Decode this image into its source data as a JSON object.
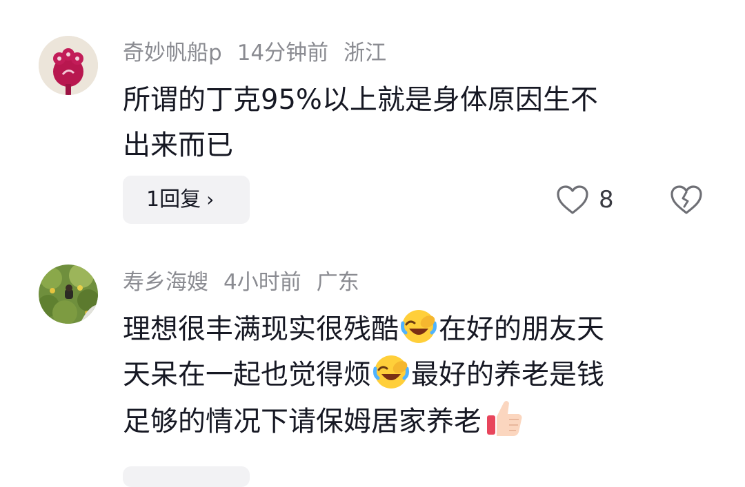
{
  "comments": [
    {
      "username": "奇妙帆船p",
      "time": "14分钟前",
      "location": "浙江",
      "line1": "所谓的丁克95%以上就是身体原因生不",
      "line2": "出来而已",
      "reply_label": "1回复",
      "reply_chevron": "›",
      "like_count": "8",
      "avatar_icon": "avatar-flower-icon"
    },
    {
      "username": "寿乡海嫂",
      "time": "4小时前",
      "location": "广东",
      "line1_a": "理想很丰满现实很残酷",
      "line1_b": "在好的朋友天",
      "line2_a": "天呆在一起也觉得烦",
      "line2_b": "最好的养老是钱",
      "line3": "足够的情况下请保姆居家养老",
      "avatar_icon": "avatar-garden-icon"
    }
  ],
  "colors": {
    "meta_text": "#8a8b91",
    "body_text": "#161823",
    "reply_bg": "#f2f2f4"
  }
}
